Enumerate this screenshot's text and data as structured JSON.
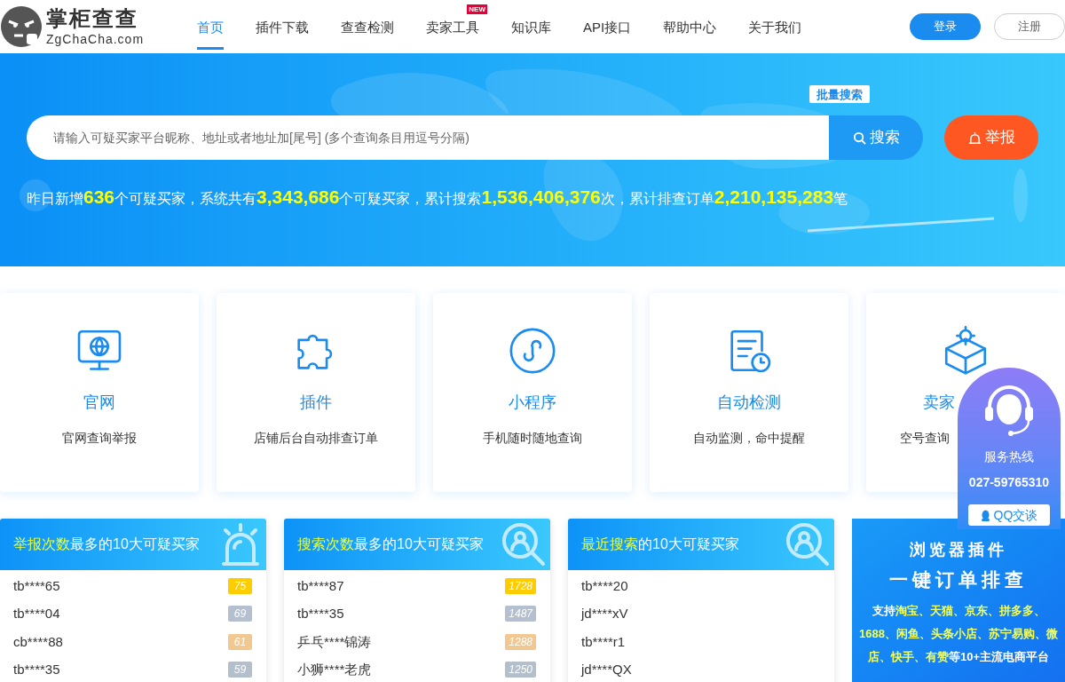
{
  "logo": {
    "name": "掌柜查查",
    "domain": "ZgChaCha.com"
  },
  "nav": [
    {
      "label": "首页",
      "selected": true
    },
    {
      "label": "插件下载",
      "selected": false
    },
    {
      "label": "查查检测",
      "selected": false
    },
    {
      "label": "卖家工具",
      "selected": false,
      "badge": "NEW"
    },
    {
      "label": "知识库",
      "selected": false
    },
    {
      "label": "API接口",
      "selected": false
    },
    {
      "label": "帮助中心",
      "selected": false
    },
    {
      "label": "关于我们",
      "selected": false
    }
  ],
  "auth": {
    "login": "登录",
    "register": "注册"
  },
  "search": {
    "batch": "批量搜索",
    "placeholder": "请输入可疑买家平台昵称、地址或者地址加[尾号] (多个查询条目用逗号分隔)",
    "button": "搜索",
    "report": "举报"
  },
  "stats": [
    {
      "text": "昨日新增",
      "highlight": false
    },
    {
      "text": "636",
      "highlight": true
    },
    {
      "text": "个可疑买家，系统共有",
      "highlight": false
    },
    {
      "text": "3,343,686",
      "highlight": true
    },
    {
      "text": "个可疑买家，累计搜索",
      "highlight": false
    },
    {
      "text": "1,536,406,376",
      "highlight": true
    },
    {
      "text": "次，累计排查订单",
      "highlight": false
    },
    {
      "text": "2,210,135,283",
      "highlight": true
    },
    {
      "text": "笔",
      "highlight": false
    }
  ],
  "features": [
    {
      "kind": "monitor",
      "title": "官网",
      "desc": "官网查询举报"
    },
    {
      "kind": "puzzle",
      "title": "插件",
      "desc": "店铺后台自动排查订单"
    },
    {
      "kind": "miniapp",
      "title": "小程序",
      "desc": "手机随时随地查询"
    },
    {
      "kind": "document",
      "title": "自动检测",
      "desc": "自动监测，命中提醒"
    },
    {
      "kind": "box",
      "title": "卖家",
      "desc": "空号查询"
    }
  ],
  "rankings": [
    {
      "kind": "alarm",
      "title_highlight": "举报次数",
      "title_rest": "最多的10大可疑买家",
      "rows": [
        {
          "name": "tb****65",
          "count": "75",
          "color": "#ffcc00"
        },
        {
          "name": "tb****04",
          "count": "69",
          "color": "#b4bfcf"
        },
        {
          "name": "cb****88",
          "count": "61",
          "color": "#f0c890"
        },
        {
          "name": "tb****35",
          "count": "59",
          "color": "#b3bfcb"
        }
      ]
    },
    {
      "kind": "search",
      "title_highlight": "搜索次数",
      "title_rest": "最多的10大可疑买家",
      "rows": [
        {
          "name": "tb****87",
          "count": "1728",
          "color": "#ffcc00"
        },
        {
          "name": "tb****35",
          "count": "1487",
          "color": "#b4bfcf"
        },
        {
          "name": "乒乓****锦涛",
          "count": "1288",
          "color": "#f0c890"
        },
        {
          "name": "小狮****老虎",
          "count": "1250",
          "color": "#b3bfcb"
        }
      ]
    },
    {
      "kind": "search",
      "title_highlight": "最近搜索",
      "title_rest": "的10大可疑买家",
      "rows": [
        {
          "name": "tb****20"
        },
        {
          "name": "jd****xV"
        },
        {
          "name": "tb****r1"
        },
        {
          "name": "jd****QX"
        }
      ]
    }
  ],
  "promo": {
    "line1": "浏览器插件",
    "line2": "一键订单排查",
    "body": [
      {
        "text": "支持",
        "highlight": false
      },
      {
        "text": "淘宝、天猫、京东、拼多多、1688、闲鱼、头条小店、苏宁易购、微店、快手、有赞",
        "highlight": true
      },
      {
        "text": "等10+主流电商平台",
        "highlight": false
      }
    ]
  },
  "service": {
    "label": "服务热线",
    "phone": "027-59765310",
    "qq": "QQ交谈"
  }
}
